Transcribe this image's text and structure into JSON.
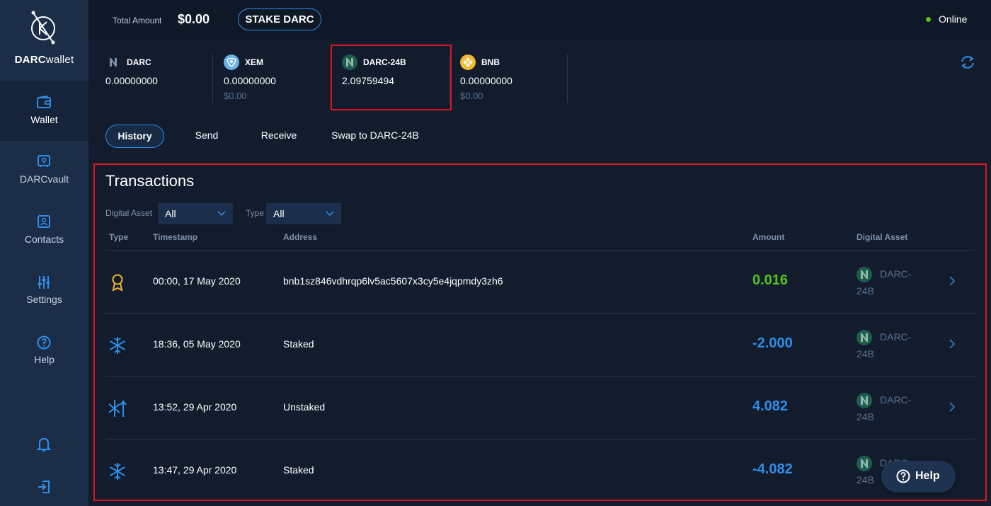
{
  "app": {
    "brand_bold": "DARC",
    "brand_thin": "wallet"
  },
  "sidebar": {
    "items": [
      {
        "label": "Wallet",
        "icon": "wallet-icon",
        "active": true
      },
      {
        "label": "DARCvault",
        "icon": "vault-icon",
        "active": false
      },
      {
        "label": "Contacts",
        "icon": "contacts-icon",
        "active": false
      },
      {
        "label": "Settings",
        "icon": "settings-sliders-icon",
        "active": false
      },
      {
        "label": "Help",
        "icon": "help-icon",
        "active": false
      }
    ],
    "bottom_icons": [
      "bell-icon",
      "logout-icon"
    ]
  },
  "topbar": {
    "total_label": "Total Amount",
    "total_value": "$0.00",
    "stake_button": "STAKE DARC",
    "status": "Online"
  },
  "assets": [
    {
      "name": "DARC",
      "balance": "0.00000000",
      "usd": ""
    },
    {
      "name": "XEM",
      "balance": "0.00000000",
      "usd": "$0.00"
    },
    {
      "name": "DARC-24B",
      "balance": "2.09759494",
      "usd": ""
    },
    {
      "name": "BNB",
      "balance": "0.00000000",
      "usd": "$0.00"
    }
  ],
  "tabs": [
    {
      "label": "History",
      "active": true
    },
    {
      "label": "Send",
      "active": false
    },
    {
      "label": "Receive",
      "active": false
    },
    {
      "label": "Swap to DARC-24B",
      "active": false
    }
  ],
  "transactions": {
    "title": "Transactions",
    "filters": {
      "digital_asset_label": "Digital Asset",
      "digital_asset_value": "All",
      "type_label": "Type",
      "type_value": "All"
    },
    "columns": {
      "type": "Type",
      "timestamp": "Timestamp",
      "address": "Address",
      "amount": "Amount",
      "asset": "Digital Asset"
    },
    "rows": [
      {
        "type_icon": "award-icon",
        "timestamp": "00:00, 17 May 2020",
        "address": "bnb1sz846vdhrqp6lv5ac5607x3cy5e4jqpmdy3zh6",
        "amount": "0.016",
        "asset": "DARC-24B"
      },
      {
        "type_icon": "snowflake-icon",
        "timestamp": "18:36, 05 May 2020",
        "address": "Staked",
        "amount": "-2.000",
        "asset": "DARC-24B"
      },
      {
        "type_icon": "unstake-icon",
        "timestamp": "13:52, 29 Apr 2020",
        "address": "Unstaked",
        "amount": "4.082",
        "asset": "DARC-24B"
      },
      {
        "type_icon": "snowflake-icon",
        "timestamp": "13:47, 29 Apr 2020",
        "address": "Staked",
        "amount": "-4.082",
        "asset": "DARC-24B"
      }
    ]
  },
  "help_button": "Help",
  "colors": {
    "accent": "#2f8ee8",
    "positive": "#52c41a",
    "highlight": "#e0141e",
    "sidebar": "#1b2d47",
    "background": "#121c2d"
  }
}
